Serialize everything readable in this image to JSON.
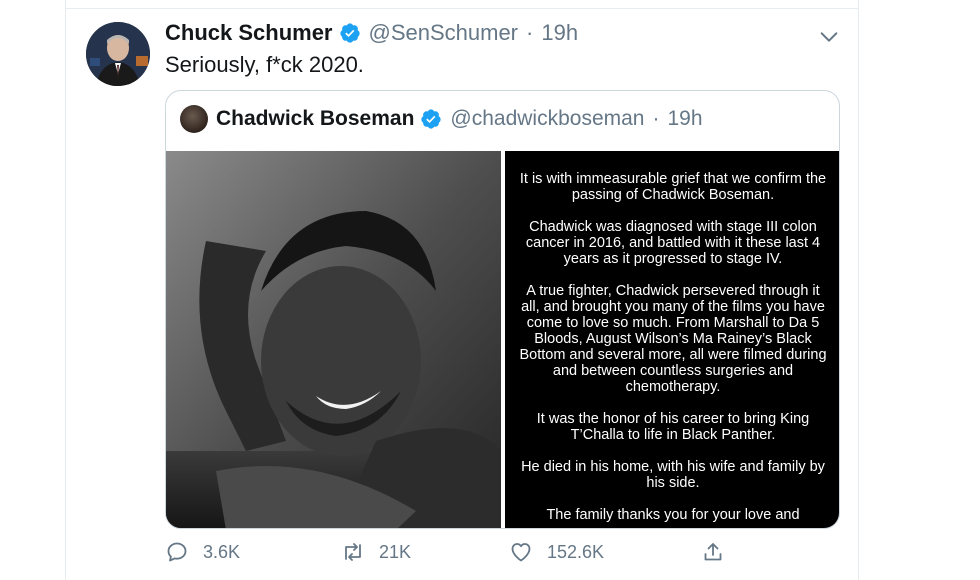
{
  "author": {
    "name": "Chuck Schumer",
    "handle": "@SenSchumer",
    "time": "19h",
    "text": "Seriously, f*ck 2020."
  },
  "quoted": {
    "name": "Chadwick Boseman",
    "handle": "@chadwickboseman",
    "time": "19h",
    "statement": [
      "It is with immeasurable grief that we confirm the passing of Chadwick Boseman.",
      "Chadwick was diagnosed with stage III colon cancer in 2016, and battled with it these last 4 years as it progressed to stage IV.",
      "A true fighter, Chadwick persevered through it all, and brought you many of the films you have come to love so much. From Marshall to Da 5 Bloods, August Wilson’s Ma Rainey’s Black Bottom and several more, all were filmed during and between countless surgeries and chemotherapy.",
      "It was the honor of his career to bring King T’Challa to life in Black Panther.",
      "He died in his home, with his wife and family by his side.",
      "The family thanks you for your love and"
    ]
  },
  "actions": {
    "reply_count": "3.6K",
    "retweet_count": "21K",
    "like_count": "152.6K"
  },
  "colors": {
    "verified": "#1da1f2",
    "secondary_text": "#657786",
    "border": "#ccd6dd"
  },
  "icons": [
    "verified-badge-icon",
    "chevron-down-icon",
    "reply-icon",
    "retweet-icon",
    "like-icon",
    "share-icon"
  ]
}
